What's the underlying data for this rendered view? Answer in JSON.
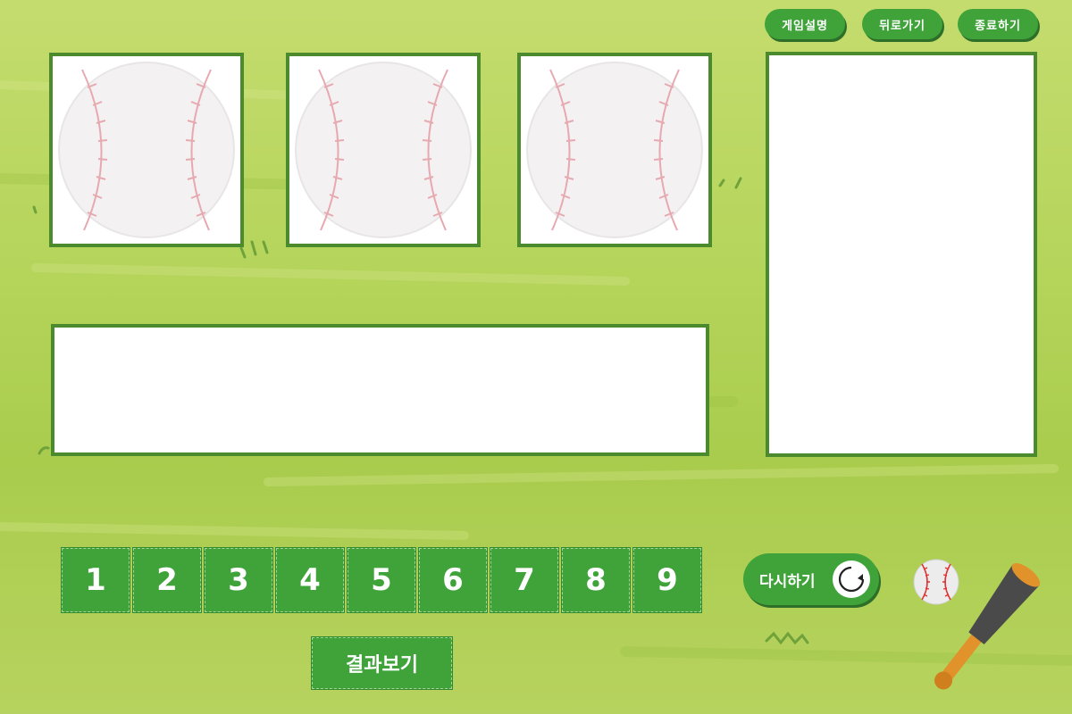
{
  "header": {
    "buttons": [
      {
        "label": "게임설명",
        "icon": "info"
      },
      {
        "label": "뒤로가기",
        "icon": "back"
      },
      {
        "label": "종료하기",
        "icon": "exit"
      }
    ]
  },
  "board": {
    "ball_slots": [
      {
        "icon": "baseball-icon"
      },
      {
        "icon": "baseball-icon"
      },
      {
        "icon": "baseball-icon"
      }
    ],
    "input_panel_text": "",
    "history_panel_text": ""
  },
  "keypad": {
    "numbers": [
      "1",
      "2",
      "3",
      "4",
      "5",
      "6",
      "7",
      "8",
      "9"
    ]
  },
  "actions": {
    "retry_label": "다시하기",
    "result_label": "결과보기"
  },
  "colors": {
    "button_green": "#3fa33a",
    "border_green": "#4c8a2e",
    "background": "#b6d55c"
  }
}
